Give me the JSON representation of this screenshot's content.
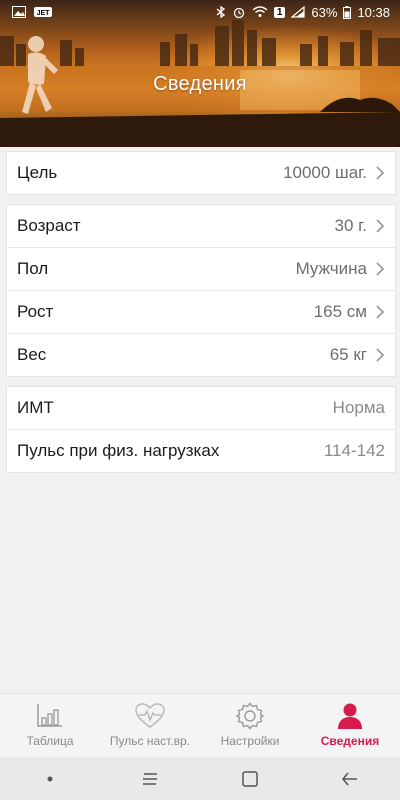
{
  "status_bar": {
    "battery": "63%",
    "time": "10:38",
    "sim_badge": "1"
  },
  "header": {
    "title": "Сведения"
  },
  "goal_card": {
    "rows": [
      {
        "label": "Цель",
        "value": "10000 шаг."
      }
    ]
  },
  "profile_card": {
    "rows": [
      {
        "label": "Возраст",
        "value": "30 г."
      },
      {
        "label": "Пол",
        "value": "Мужчина"
      },
      {
        "label": "Рост",
        "value": "165 см"
      },
      {
        "label": "Вес",
        "value": "65 кг"
      }
    ]
  },
  "stats_card": {
    "rows": [
      {
        "label": "ИМТ",
        "value": "Норма"
      },
      {
        "label": "Пульс при физ. нагрузках",
        "value": "114-142"
      }
    ]
  },
  "tabs": [
    {
      "label": "Таблица",
      "icon": "bar-chart-icon"
    },
    {
      "label": "Пульс наст.вр.",
      "icon": "heart-pulse-icon"
    },
    {
      "label": "Настройки",
      "icon": "gear-icon"
    },
    {
      "label": "Сведения",
      "icon": "person-icon"
    }
  ],
  "active_tab_index": 3,
  "colors": {
    "accent": "#d81b4f",
    "header_sky": "#e98b2a"
  }
}
